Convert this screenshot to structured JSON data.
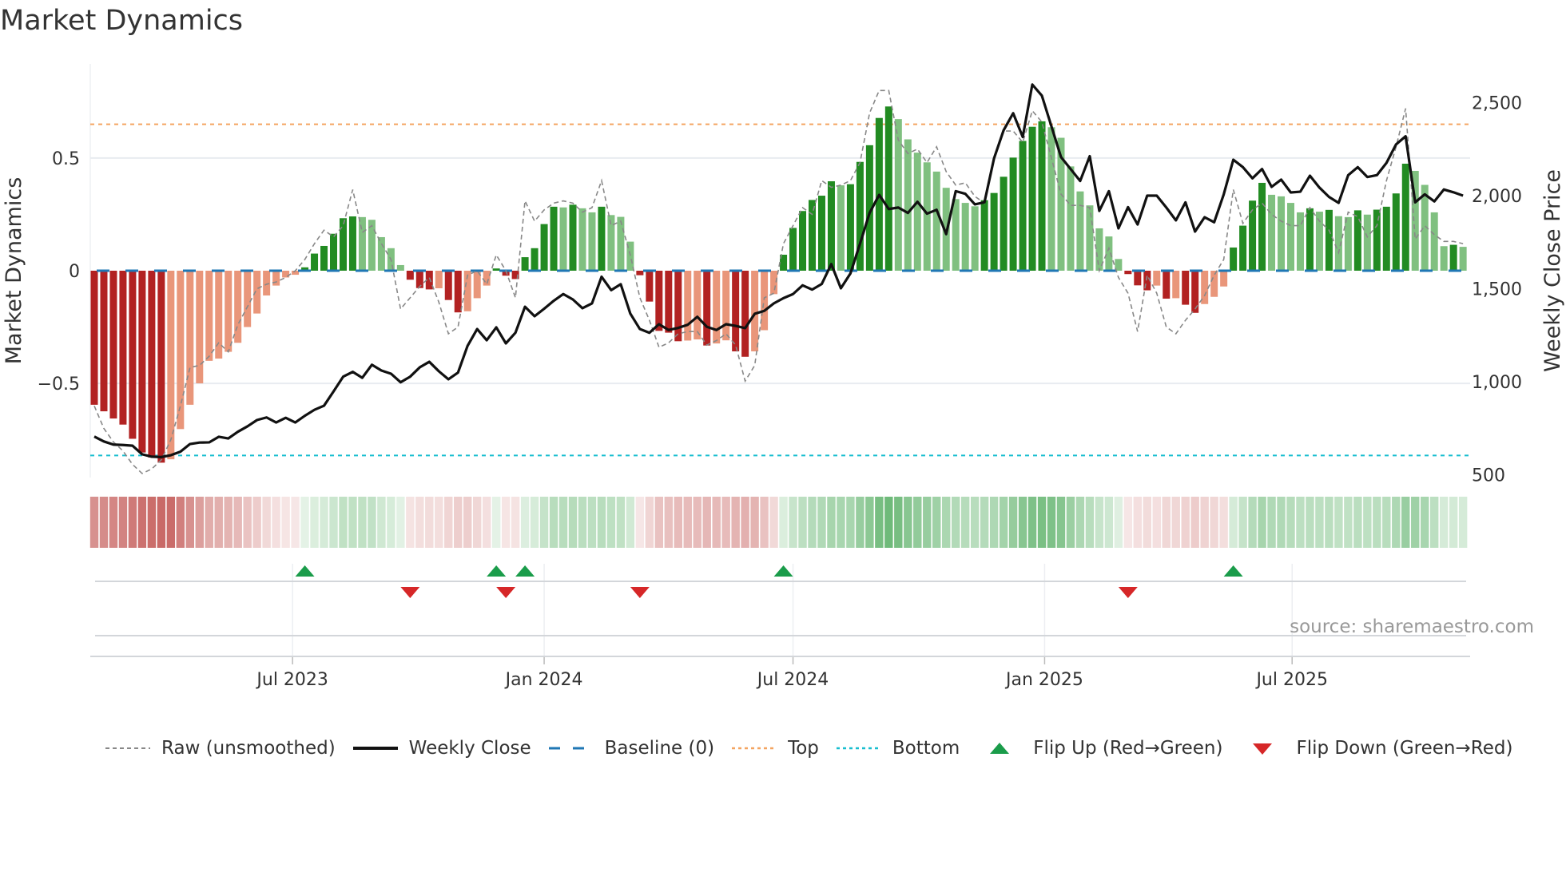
{
  "title": "Market Dynamics",
  "source": "source: sharemaestro.com",
  "colors": {
    "dark_red": "#b22222",
    "light_red": "#e9967a",
    "dark_green": "#228b22",
    "light_green": "#80c080",
    "raw": "#888888",
    "close": "#111111",
    "baseline": "#1f77b4",
    "top": "#f4a460",
    "bottom": "#17becf",
    "flip_up": "#1a9c4a",
    "flip_down": "#d62728",
    "heat_red": "#c0504d",
    "heat_green": "#3fa34d"
  },
  "legend": [
    {
      "key": "raw",
      "label": "Raw (unsmoothed)"
    },
    {
      "key": "close",
      "label": "Weekly Close"
    },
    {
      "key": "baseline",
      "label": "Baseline (0)"
    },
    {
      "key": "top",
      "label": "Top"
    },
    {
      "key": "bottom",
      "label": "Bottom"
    },
    {
      "key": "flip_up",
      "label": "Flip Up (Red→Green)"
    },
    {
      "key": "flip_down",
      "label": "Flip Down (Green→Red)"
    }
  ],
  "chart_data": {
    "type": "bar",
    "title": "Market Dynamics",
    "ylabel": "Market Dynamics",
    "y2label": "Weekly Close Price",
    "start_date": "2023-02-06",
    "interval_days": 7,
    "ylim": [
      -0.918,
      0.918
    ],
    "y2lim": [
      485,
      2708
    ],
    "yticks": [
      {
        "v": 0.5,
        "label": "0.5"
      },
      {
        "v": 0,
        "label": "0"
      },
      {
        "v": -0.5,
        "label": "−0.5"
      }
    ],
    "y2ticks": [
      {
        "v": 2500,
        "label": "2,500"
      },
      {
        "v": 2000,
        "label": "2,000"
      },
      {
        "v": 1500,
        "label": "1,500"
      },
      {
        "v": 1000,
        "label": "1,000"
      },
      {
        "v": 500,
        "label": "500"
      }
    ],
    "xticks": [
      {
        "date": "2023-07-01",
        "label": "Jul 2023"
      },
      {
        "date": "2024-01-01",
        "label": "Jan 2024"
      },
      {
        "date": "2024-07-01",
        "label": "Jul 2024"
      },
      {
        "date": "2025-01-01",
        "label": "Jan 2025"
      },
      {
        "date": "2025-07-01",
        "label": "Jul 2025"
      }
    ],
    "top_level": 0.65,
    "bottom_level": -0.82,
    "baseline": 0,
    "momentum": [
      -0.595,
      -0.624,
      -0.656,
      -0.683,
      -0.746,
      -0.807,
      -0.829,
      -0.852,
      -0.837,
      -0.703,
      -0.595,
      -0.5,
      -0.4,
      -0.39,
      -0.36,
      -0.32,
      -0.25,
      -0.19,
      -0.11,
      -0.066,
      -0.03,
      -0.018,
      0.015,
      0.076,
      0.11,
      0.164,
      0.233,
      0.241,
      0.238,
      0.226,
      0.149,
      0.1,
      0.025,
      -0.04,
      -0.077,
      -0.083,
      -0.078,
      -0.13,
      -0.185,
      -0.18,
      -0.122,
      -0.066,
      0.01,
      -0.022,
      -0.037,
      0.06,
      0.1,
      0.207,
      0.284,
      0.281,
      0.293,
      0.277,
      0.259,
      0.284,
      0.247,
      0.239,
      0.129,
      -0.02,
      -0.137,
      -0.267,
      -0.275,
      -0.313,
      -0.31,
      -0.305,
      -0.332,
      -0.323,
      -0.309,
      -0.358,
      -0.382,
      -0.358,
      -0.264,
      -0.104,
      0.071,
      0.19,
      0.265,
      0.314,
      0.333,
      0.397,
      0.379,
      0.384,
      0.483,
      0.557,
      0.678,
      0.729,
      0.673,
      0.583,
      0.524,
      0.481,
      0.44,
      0.368,
      0.318,
      0.301,
      0.286,
      0.313,
      0.345,
      0.417,
      0.502,
      0.576,
      0.639,
      0.663,
      0.637,
      0.59,
      0.463,
      0.352,
      0.29,
      0.188,
      0.152,
      0.052,
      -0.015,
      -0.065,
      -0.087,
      -0.066,
      -0.124,
      -0.122,
      -0.151,
      -0.187,
      -0.148,
      -0.116,
      -0.07,
      0.103,
      0.2,
      0.311,
      0.39,
      0.337,
      0.33,
      0.301,
      0.259,
      0.277,
      0.262,
      0.27,
      0.242,
      0.238,
      0.268,
      0.249,
      0.271,
      0.284,
      0.343,
      0.475,
      0.443,
      0.381,
      0.259,
      0.109,
      0.115,
      0.106
    ],
    "raw": [
      -0.6,
      -0.7,
      -0.76,
      -0.8,
      -0.86,
      -0.9,
      -0.88,
      -0.84,
      -0.75,
      -0.6,
      -0.43,
      -0.42,
      -0.38,
      -0.32,
      -0.36,
      -0.24,
      -0.16,
      -0.08,
      -0.06,
      -0.05,
      -0.03,
      0.0,
      0.05,
      0.12,
      0.18,
      0.15,
      0.2,
      0.36,
      0.17,
      0.2,
      0.12,
      0.05,
      -0.17,
      -0.12,
      -0.07,
      -0.03,
      -0.14,
      -0.28,
      -0.25,
      -0.02,
      0.0,
      -0.06,
      0.07,
      0.0,
      -0.12,
      0.31,
      0.22,
      0.27,
      0.3,
      0.31,
      0.3,
      0.26,
      0.28,
      0.4,
      0.2,
      0.22,
      0.07,
      -0.12,
      -0.22,
      -0.34,
      -0.32,
      -0.28,
      -0.27,
      -0.27,
      -0.33,
      -0.31,
      -0.28,
      -0.33,
      -0.49,
      -0.42,
      -0.12,
      -0.1,
      0.12,
      0.2,
      0.28,
      0.25,
      0.4,
      0.37,
      0.38,
      0.4,
      0.48,
      0.7,
      0.8,
      0.8,
      0.58,
      0.52,
      0.54,
      0.48,
      0.55,
      0.44,
      0.38,
      0.39,
      0.33,
      0.3,
      0.5,
      0.62,
      0.62,
      0.57,
      0.71,
      0.66,
      0.5,
      0.34,
      0.29,
      0.29,
      0.28,
      0.0,
      0.1,
      -0.03,
      -0.1,
      -0.27,
      -0.02,
      -0.1,
      -0.25,
      -0.28,
      -0.22,
      -0.17,
      -0.11,
      -0.02,
      0.05,
      0.36,
      0.21,
      0.27,
      0.3,
      0.25,
      0.22,
      0.2,
      0.2,
      0.28,
      0.22,
      0.18,
      0.08,
      0.26,
      0.24,
      0.15,
      0.2,
      0.4,
      0.55,
      0.72,
      0.14,
      0.2,
      0.16,
      0.13,
      0.13,
      0.12
    ],
    "weekly_close": [
      705,
      679,
      662,
      660,
      656,
      610,
      597,
      595,
      605,
      624,
      665,
      673,
      674,
      704,
      695,
      731,
      760,
      794,
      808,
      781,
      806,
      781,
      817,
      849,
      871,
      948,
      1027,
      1053,
      1021,
      1091,
      1060,
      1043,
      997,
      1027,
      1077,
      1107,
      1056,
      1013,
      1049,
      1193,
      1283,
      1223,
      1292,
      1206,
      1263,
      1403,
      1352,
      1392,
      1435,
      1471,
      1442,
      1395,
      1421,
      1564,
      1492,
      1524,
      1366,
      1283,
      1263,
      1309,
      1278,
      1289,
      1306,
      1349,
      1295,
      1278,
      1309,
      1300,
      1288,
      1365,
      1381,
      1421,
      1449,
      1471,
      1518,
      1495,
      1525,
      1632,
      1502,
      1582,
      1742,
      1907,
      2004,
      1928,
      1936,
      1907,
      1967,
      1903,
      1924,
      1793,
      2024,
      2010,
      1953,
      1964,
      2200,
      2351,
      2443,
      2315,
      2597,
      2537,
      2372,
      2207,
      2143,
      2079,
      2212,
      1918,
      2024,
      1824,
      1938,
      1845,
      2000,
      2000,
      1936,
      1867,
      1964,
      1807,
      1884,
      1857,
      2007,
      2193,
      2153,
      2093,
      2143,
      2047,
      2086,
      2017,
      2021,
      2107,
      2043,
      1993,
      1961,
      2110,
      2153,
      2100,
      2110,
      2176,
      2275,
      2319,
      1964,
      2007,
      1969,
      2033,
      2018,
      2000
    ],
    "flip_up_weeks": [
      22,
      42,
      45,
      72,
      119
    ],
    "flip_down_weeks": [
      33,
      43,
      57,
      108
    ],
    "legend_position": "bottom"
  }
}
